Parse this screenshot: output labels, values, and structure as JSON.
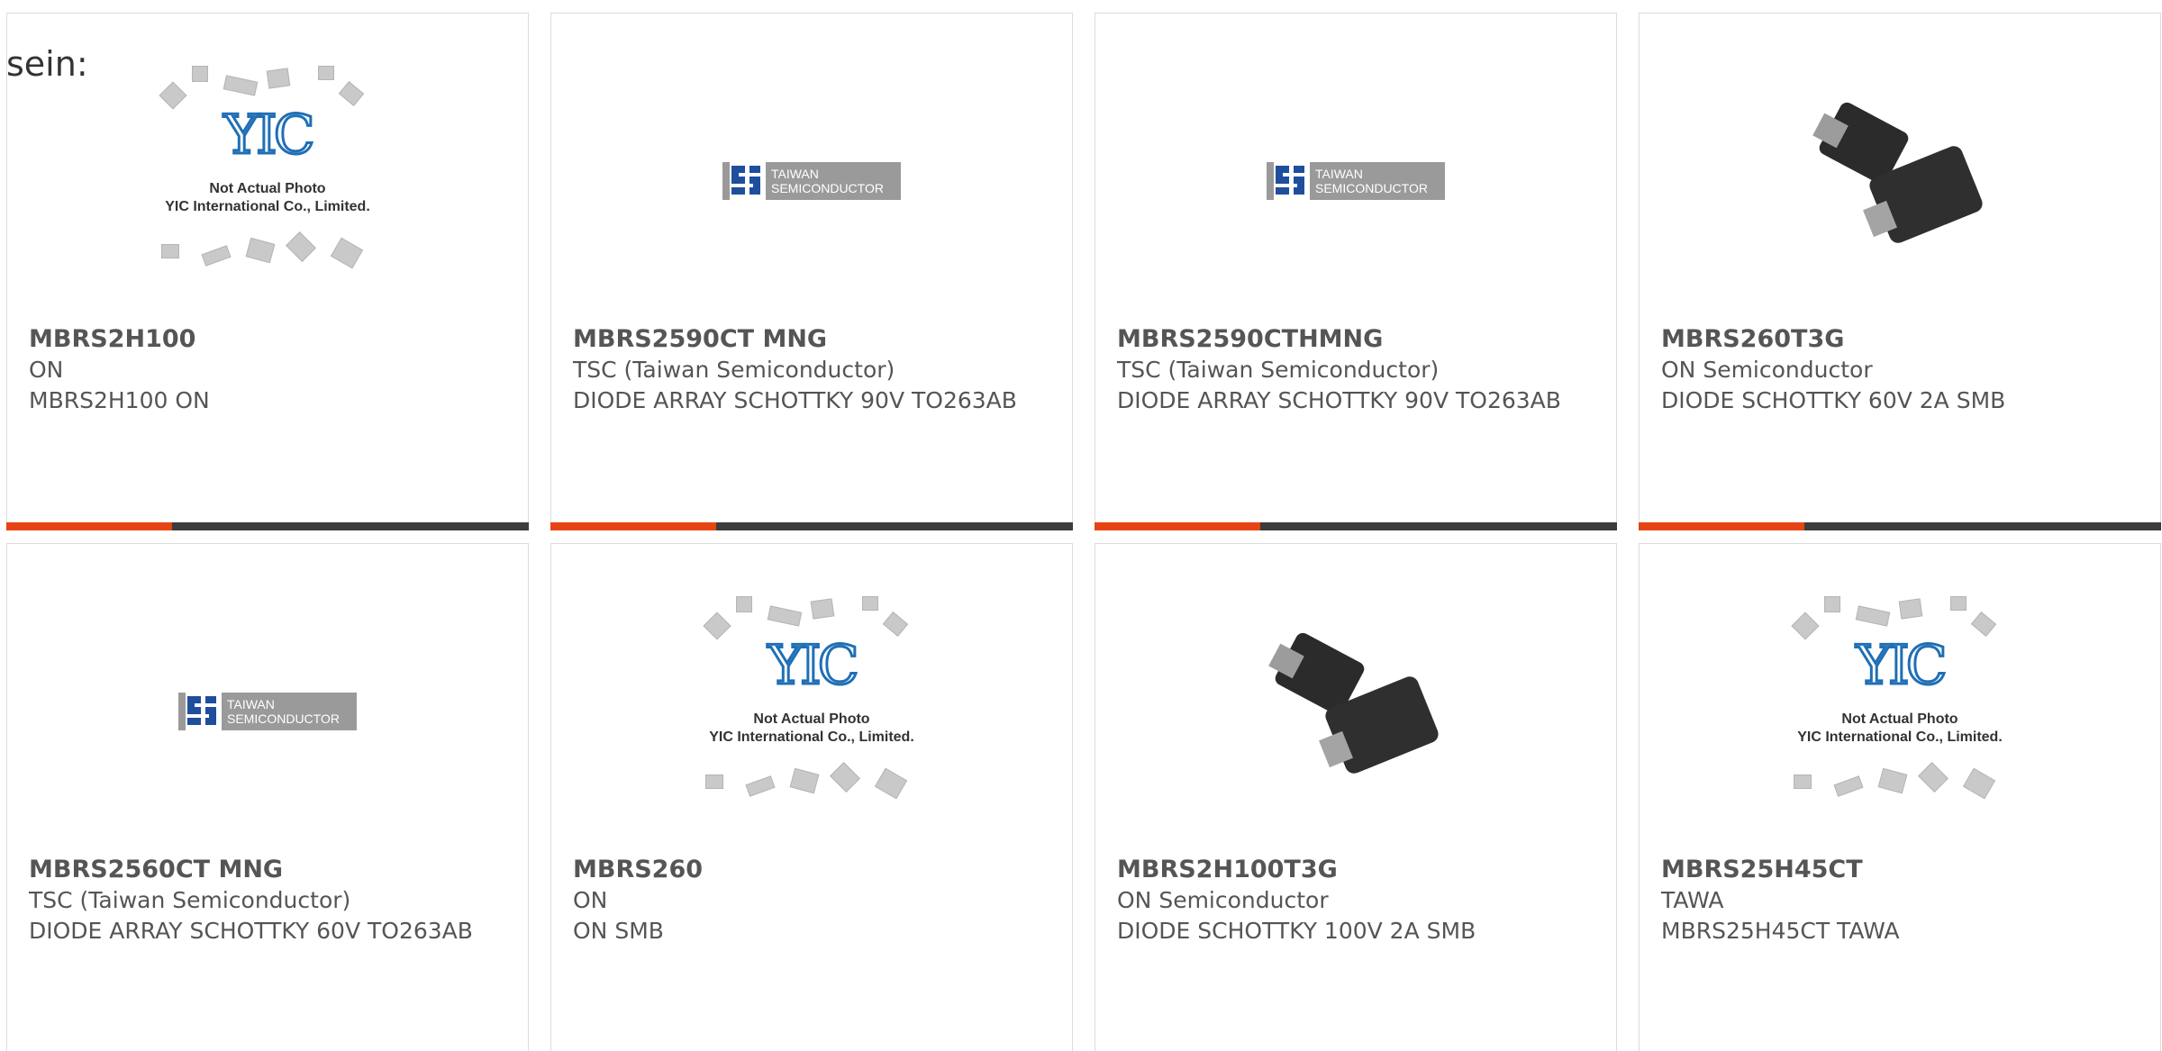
{
  "lead_text": "sein:",
  "colors": {
    "accent": "#e64415",
    "bar": "#3c3c3c",
    "text": "#555555",
    "border": "#dcdcdc"
  },
  "products": [
    {
      "part": "MBRS2H100",
      "manufacturer": "ON",
      "description": "MBRS2H100 ON",
      "image": "yic-placeholder"
    },
    {
      "part": "MBRS2590CT MNG",
      "manufacturer": "TSC (Taiwan Semiconductor)",
      "description": "DIODE ARRAY SCHOTTKY 90V TO263AB",
      "image": "taiwan-semiconductor-logo"
    },
    {
      "part": "MBRS2590CTHMNG",
      "manufacturer": "TSC (Taiwan Semiconductor)",
      "description": "DIODE ARRAY SCHOTTKY 90V TO263AB",
      "image": "taiwan-semiconductor-logo"
    },
    {
      "part": "MBRS260T3G",
      "manufacturer": "ON Semiconductor",
      "description": "DIODE SCHOTTKY 60V 2A SMB",
      "image": "smb-diode-photo"
    },
    {
      "part": "MBRS2560CT MNG",
      "manufacturer": "TSC (Taiwan Semiconductor)",
      "description": "DIODE ARRAY SCHOTTKY 60V TO263AB",
      "image": "taiwan-semiconductor-logo"
    },
    {
      "part": "MBRS260",
      "manufacturer": "ON",
      "description": "ON SMB",
      "image": "yic-placeholder"
    },
    {
      "part": "MBRS2H100T3G",
      "manufacturer": "ON Semiconductor",
      "description": "DIODE SCHOTTKY 100V 2A SMB",
      "image": "smb-diode-photo"
    },
    {
      "part": "MBRS25H45CT",
      "manufacturer": "TAWA",
      "description": "MBRS25H45CT TAWA",
      "image": "yic-placeholder"
    }
  ],
  "logos": {
    "tsc_line1": "TAIWAN",
    "tsc_line2": "SEMICONDUCTOR",
    "yic_mark": "YIC",
    "yic_note1": "Not Actual Photo",
    "yic_note2": "YIC International Co., Limited."
  }
}
